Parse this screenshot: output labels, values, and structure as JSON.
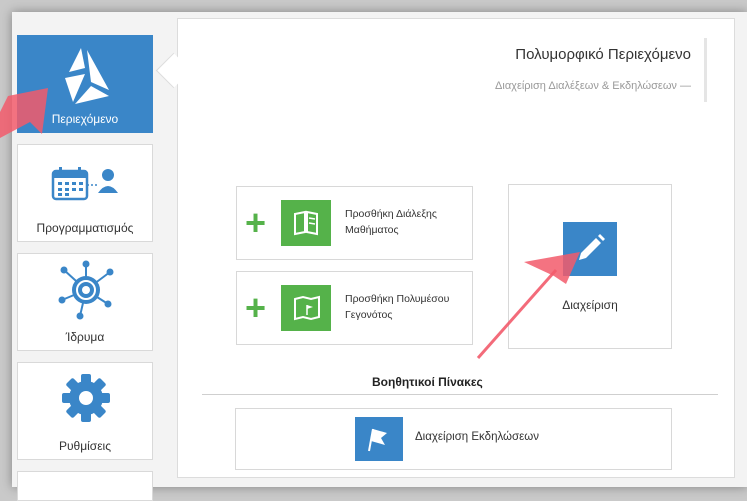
{
  "sidebar": {
    "items": [
      {
        "label": "Περιεχόμενο",
        "icon": "content-logo-icon",
        "active": true
      },
      {
        "label": "Προγραμματισμός",
        "icon": "calendar-user-icon",
        "active": false
      },
      {
        "label": "Ίδρυμα",
        "icon": "institution-network-icon",
        "active": false
      },
      {
        "label": "Ρυθμίσεις",
        "icon": "gear-icon",
        "active": false
      }
    ]
  },
  "header": {
    "title": "Πολυμορφικό Περιεχόμενο",
    "subtitle": "Διαχείριση Διαλέξεων & Εκδηλώσεων —"
  },
  "actions": {
    "add_lecture": {
      "line1": "Προσθήκη Διάλεξης",
      "line2": "Μαθήματος"
    },
    "add_event": {
      "line1": "Προσθήκη Πολυμέσου",
      "line2": "Γεγονότος"
    },
    "manage": {
      "label": "Διαχείριση"
    }
  },
  "aux": {
    "title": "Βοηθητικοί Πίνακες",
    "manage_events": "Διαχείριση Εκδηλώσεων"
  },
  "colors": {
    "accent_blue": "#3a86c8",
    "accent_green": "#55b24a",
    "arrow_red": "#f25b6b"
  }
}
